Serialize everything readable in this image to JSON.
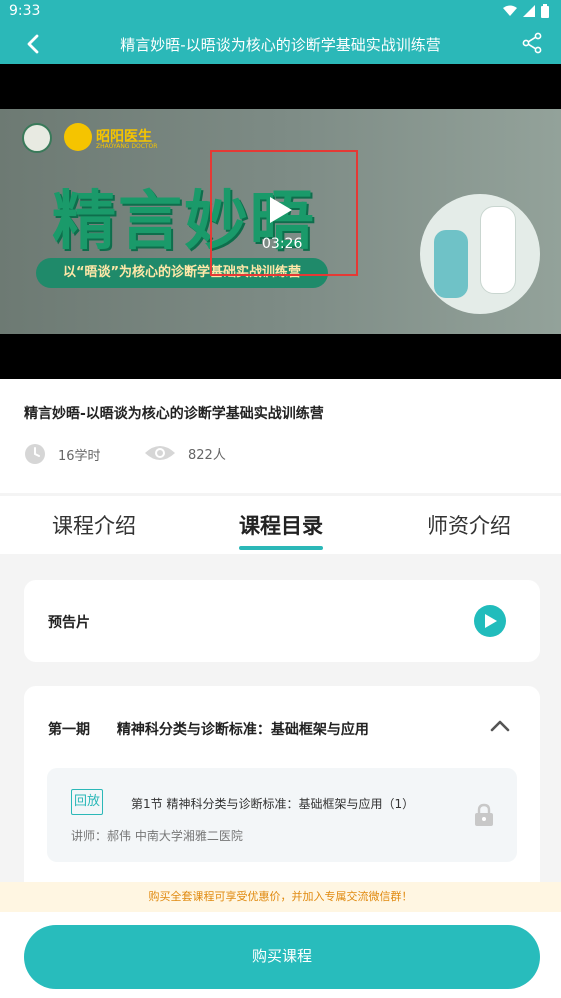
{
  "status_bar": {
    "time": "9:33"
  },
  "navbar": {
    "title": "精言妙晤-以晤谈为核心的诊断学基础实战训练营"
  },
  "video": {
    "brand": "昭阳医生",
    "brand_sub": "ZHAOYANG DOCTOR",
    "big_title": "精言妙晤",
    "ribbon": "以“晤谈”为核心的诊断学基础实战训练营",
    "duration": "03:26"
  },
  "course": {
    "title": "精言妙晤-以晤谈为核心的诊断学基础实战训练营",
    "hours": "16学时",
    "viewers": "822人"
  },
  "tabs": [
    {
      "label": "课程介绍"
    },
    {
      "label": "课程目录"
    },
    {
      "label": "师资介绍"
    }
  ],
  "trailer": {
    "label": "预告片"
  },
  "period": {
    "index": "第一期",
    "name": "精神科分类与诊断标准：基础框架与应用",
    "lesson": {
      "tag": "回放",
      "title": "第1节 精神科分类与诊断标准：基础框架与应用（1）",
      "teacher": "讲师：郝伟  中南大学湘雅二医院"
    }
  },
  "promo": "购买全套课程可享受优惠价，并加入专属交流微信群！",
  "buy_button": "购买课程",
  "colors": {
    "accent": "#2bb8b8",
    "promo_text": "#e08a10",
    "frame": "#e53935"
  }
}
